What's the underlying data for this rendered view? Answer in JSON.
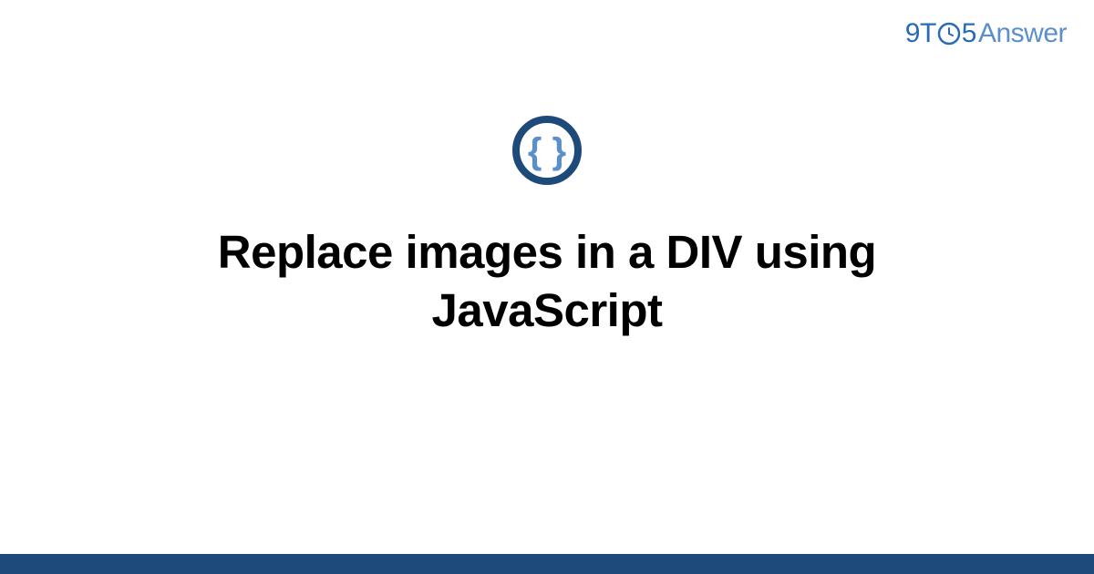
{
  "logo": {
    "part1": "9",
    "part2": "T",
    "part3": "5",
    "part4": "Answer"
  },
  "main": {
    "title": "Replace images in a DIV using JavaScript"
  },
  "colors": {
    "logo_primary": "#2a6bb8",
    "logo_secondary": "#5a8fc9",
    "icon_ring": "#1e4a7a",
    "icon_braces": "#5a8fc9",
    "bottom_bar": "#1e4a7a"
  }
}
